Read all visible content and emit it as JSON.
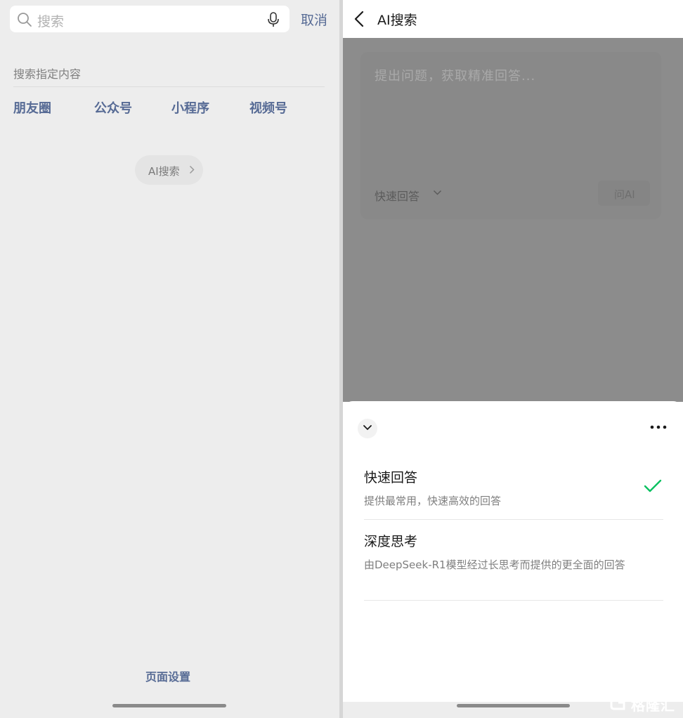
{
  "left_panel": {
    "search": {
      "placeholder": "搜索",
      "cancel_label": "取消"
    },
    "section_title": "搜索指定内容",
    "categories": [
      "朋友圈",
      "公众号",
      "小程序",
      "视频号"
    ],
    "ai_search_pill": "AI搜索",
    "page_settings": "页面设置"
  },
  "right_panel": {
    "header_title": "AI搜索",
    "question_placeholder": "提出问题，获取精准回答...",
    "mode_selector_label": "快速回答",
    "ask_button_label": "问AI",
    "sheet": {
      "options": [
        {
          "title": "快速回答",
          "description": "提供最常用，快速高效的回答",
          "selected": true
        },
        {
          "title": "深度思考",
          "description": "由DeepSeek-R1模型经过长思考而提供的更全面的回答",
          "selected": false
        }
      ]
    }
  },
  "watermark": {
    "text": "格隆汇"
  },
  "colors": {
    "link_blue": "#576b95",
    "check_green": "#07c160",
    "overlay_gray": "#8c8c8c"
  },
  "icons": [
    "search-icon",
    "mic-icon",
    "chevron-right-icon",
    "back-arrow-icon",
    "chevron-down-icon",
    "more-icon",
    "check-icon"
  ]
}
